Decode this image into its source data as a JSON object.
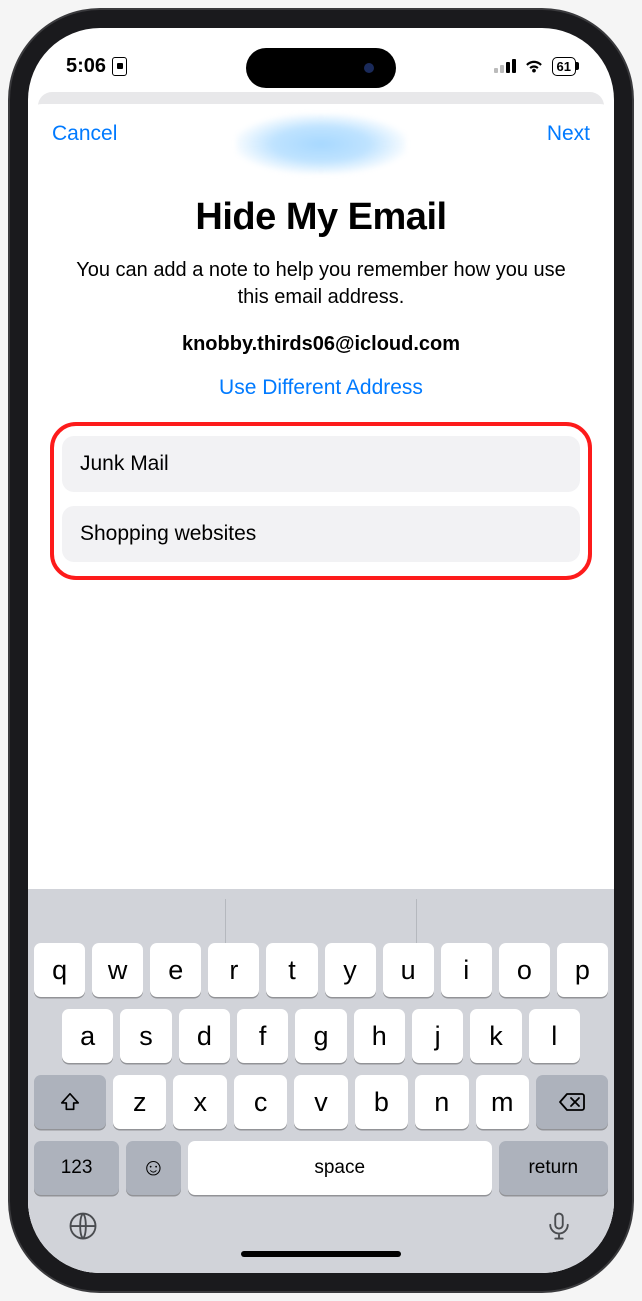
{
  "status": {
    "time": "5:06",
    "battery": "61"
  },
  "sheet": {
    "cancel": "Cancel",
    "next": "Next",
    "title": "Hide My Email",
    "subtitle": "You can add a note to help you remember how you use this email address.",
    "email": "knobby.thirds06@icloud.com",
    "different": "Use Different Address",
    "label_value": "Junk Mail",
    "note_value": "Shopping websites"
  },
  "keyboard": {
    "row1": [
      "q",
      "w",
      "e",
      "r",
      "t",
      "y",
      "u",
      "i",
      "o",
      "p"
    ],
    "row2": [
      "a",
      "s",
      "d",
      "f",
      "g",
      "h",
      "j",
      "k",
      "l"
    ],
    "row3": [
      "z",
      "x",
      "c",
      "v",
      "b",
      "n",
      "m"
    ],
    "numbers": "123",
    "space": "space",
    "return": "return"
  }
}
